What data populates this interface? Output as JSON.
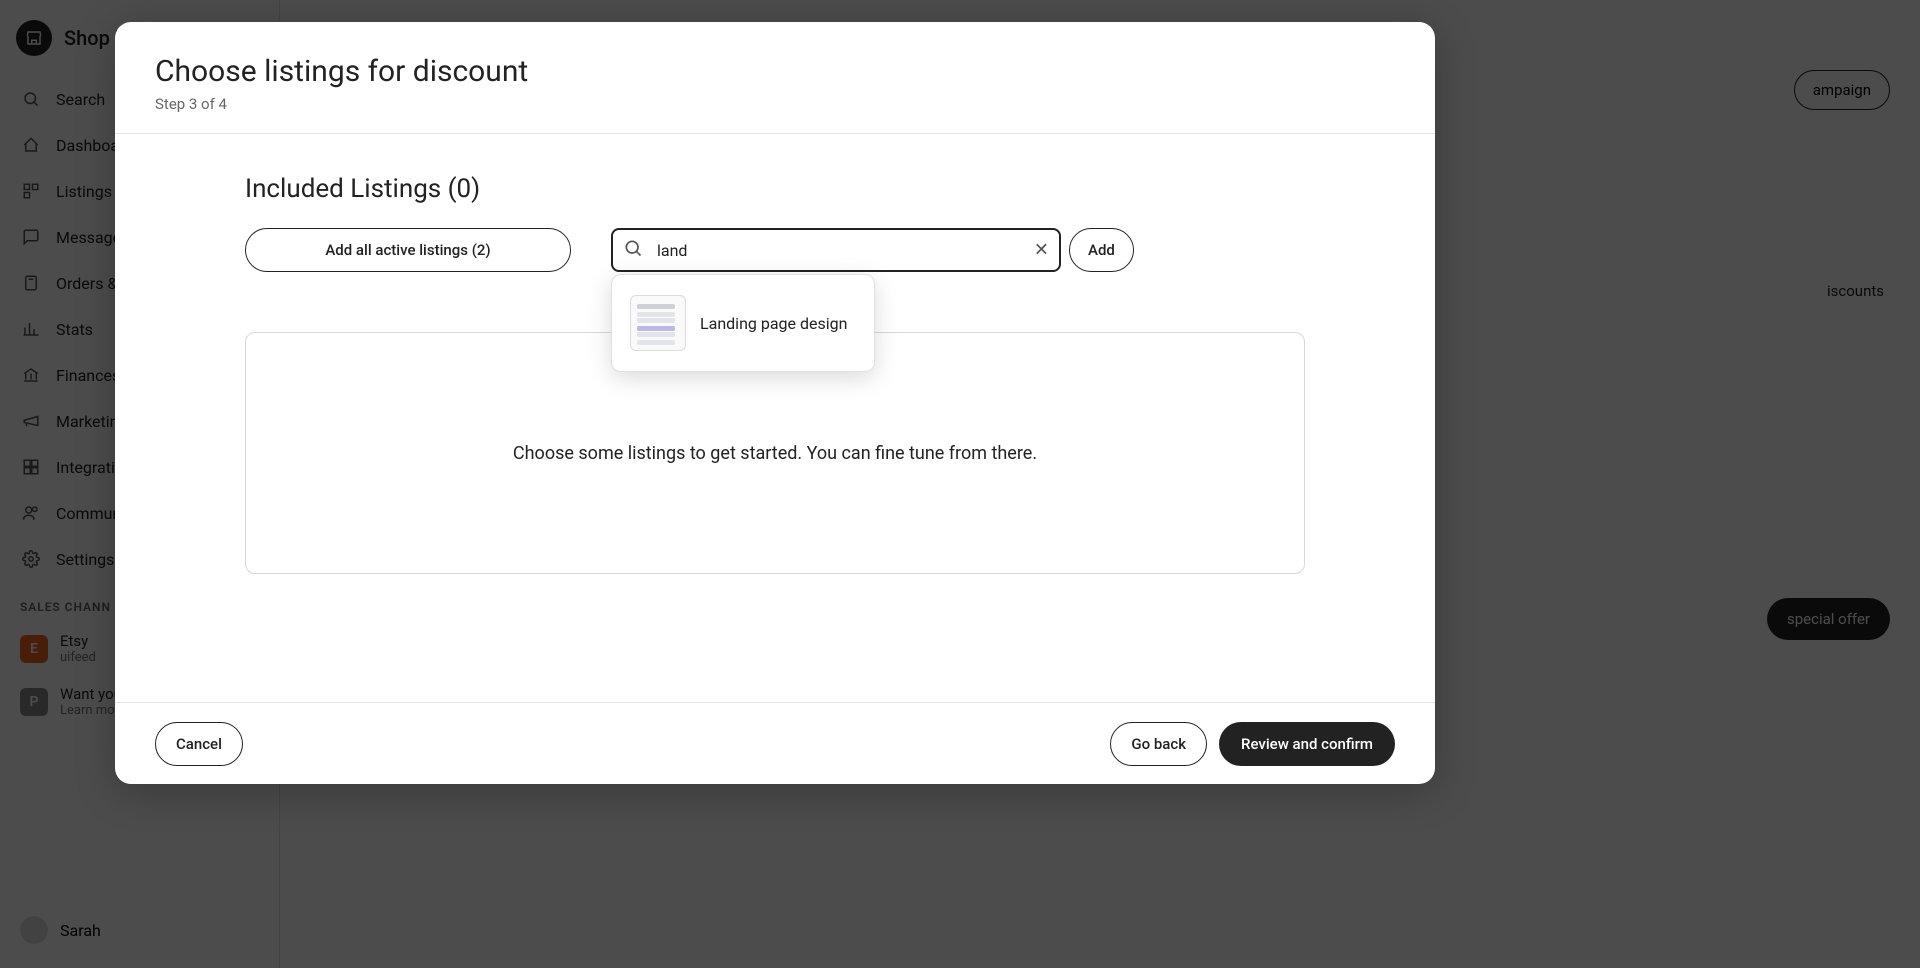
{
  "brand": {
    "name": "Shop M"
  },
  "sidebar": {
    "items": [
      {
        "label": "Search"
      },
      {
        "label": "Dashboa"
      },
      {
        "label": "Listings"
      },
      {
        "label": "Message"
      },
      {
        "label": "Orders &"
      },
      {
        "label": "Stats"
      },
      {
        "label": "Finances"
      },
      {
        "label": "Marketin"
      },
      {
        "label": "Integrati"
      },
      {
        "label": "Commun"
      },
      {
        "label": "Settings"
      }
    ],
    "section_label": "SALES CHANN",
    "channels": [
      {
        "badge": "E",
        "title": "Etsy",
        "subtitle": "uifeed"
      },
      {
        "badge": "P",
        "title": "Want you",
        "subtitle": "Learn mo"
      }
    ]
  },
  "user": {
    "name": "Sarah"
  },
  "bg": {
    "campaign_btn": "ampaign",
    "discounts_text": "iscounts",
    "special_offer_btn": "special offer"
  },
  "modal": {
    "title": "Choose listings for discount",
    "step": "Step 3 of 4",
    "heading": "Included Listings (0)",
    "add_all_label": "Add all active listings (2)",
    "search_value": "land",
    "add_label": "Add",
    "dropdown": {
      "items": [
        {
          "label": "Landing page design"
        }
      ]
    },
    "empty_text": "Choose some listings to get started. You can fine tune from there.",
    "footer": {
      "cancel": "Cancel",
      "go_back": "Go back",
      "confirm": "Review and confirm"
    }
  }
}
